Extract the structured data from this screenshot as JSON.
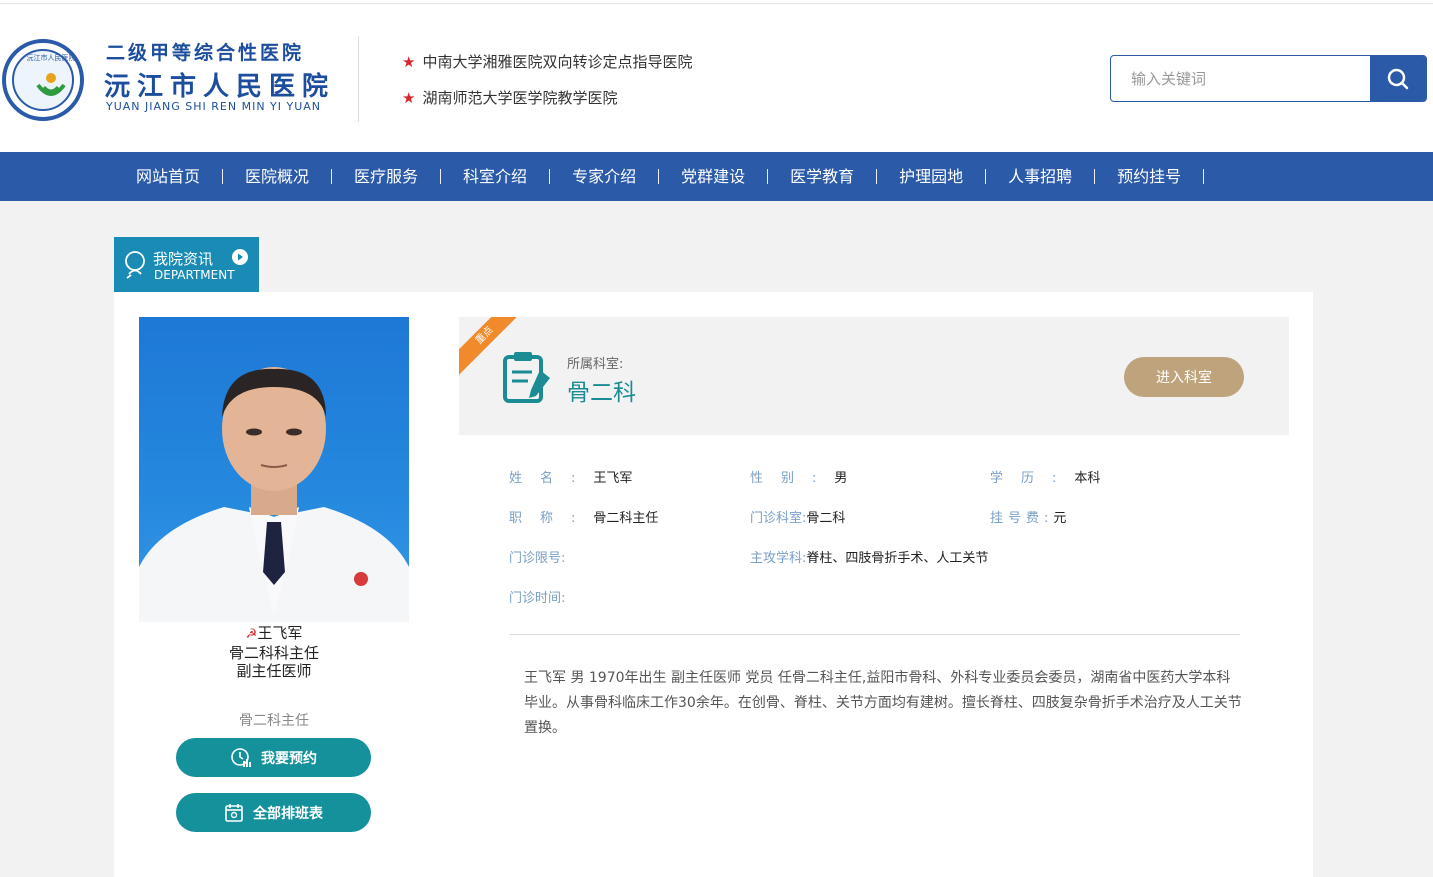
{
  "header": {
    "logo_ring_text": "沅江市人民医院",
    "logo_top": "二级甲等综合性医院",
    "logo_main": "沅江市人民医院",
    "logo_pinyin": "YUAN JIANG SHI REN MIN YI YUAN",
    "honors": [
      "中南大学湘雅医院双向转诊定点指导医院",
      "湖南师范大学医学院教学医院"
    ]
  },
  "search": {
    "placeholder": "输入关键词"
  },
  "nav": {
    "items": [
      "网站首页",
      "医院概况",
      "医疗服务",
      "科室介绍",
      "专家介绍",
      "党群建设",
      "医学教育",
      "护理园地",
      "人事招聘",
      "预约挂号"
    ]
  },
  "section": {
    "title": "我院资讯",
    "subtitle": "DEPARTMENT"
  },
  "doctor": {
    "name": "王飞军",
    "title_line": "骨二科科主任",
    "rank_line": "副主任医师",
    "dept_short": "骨二科主任",
    "book_label": "我要预约",
    "schedule_label": "全部排班表"
  },
  "department": {
    "badge": "重点",
    "label": "所属科室:",
    "name": "骨二科",
    "enter_label": "进入科室"
  },
  "info": {
    "name_label": "姓名:",
    "name_value": "王飞军",
    "gender_label": "性别:",
    "gender_value": "男",
    "edu_label": "学历:",
    "edu_value": "本科",
    "title_label": "职称:",
    "title_value": "骨二科主任",
    "clinic_label": "门诊科室:",
    "clinic_value": "骨二科",
    "fee_label": "挂号费:",
    "fee_value": "元",
    "limit_label": "门诊限号:",
    "limit_value": "",
    "specialty_label": "主攻学科:",
    "specialty_value": "脊柱、四肢骨折手术、人工关节",
    "time_label": "门诊时间:",
    "time_value": ""
  },
  "intro": "王飞军 男 1970年出生 副主任医师 党员 任骨二科主任,益阳市骨科、外科专业委员会委员，湖南省中医药大学本科毕业。从事骨科临床工作30余年。在创骨、脊柱、关节方面均有建树。擅长脊柱、四肢复杂骨折手术治疗及人工关节置换。",
  "colors": {
    "brand_blue": "#2a5aa8",
    "teal": "#14919b",
    "gold": "#bfa37c",
    "ribbon": "#f08a2b",
    "star": "#d6262b"
  }
}
